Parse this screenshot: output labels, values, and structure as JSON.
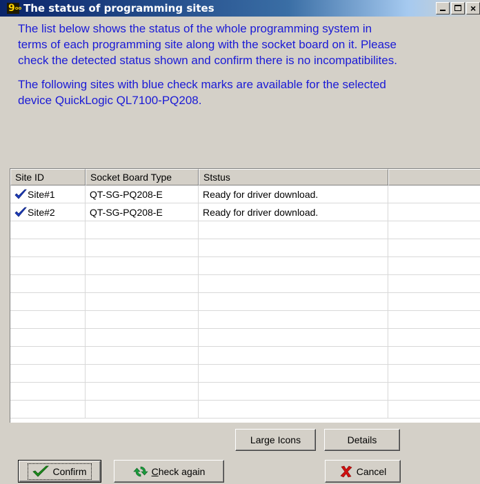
{
  "window": {
    "icon_text": "9",
    "icon_sub": "oo",
    "title": "The status of programming sites"
  },
  "description": {
    "paragraph1": "The list below shows the status of the whole programming system in terms of each programming site along with the socket board on it. Please check the detected status shown and confirm there is no incompatibilites.",
    "paragraph2": "The following sites with blue check marks are available for the selected device QuickLogic QL7100-PQ208."
  },
  "table": {
    "columns": [
      "Site ID",
      "Socket Board Type",
      "Ststus",
      ""
    ],
    "rows": [
      {
        "site_id": "Site#1",
        "socket_board": "QT-SG-PQ208-E",
        "status": "Ready for driver download.",
        "icon": "blue-check-icon"
      },
      {
        "site_id": "Site#2",
        "socket_board": "QT-SG-PQ208-E",
        "status": "Ready for driver download.",
        "icon": "blue-check-icon"
      }
    ]
  },
  "buttons": {
    "large_icons": "Large Icons",
    "details": "Details",
    "confirm": "Confirm",
    "check_again": "Check again",
    "cancel": "Cancel"
  },
  "colors": {
    "description_text": "#1a1ad6",
    "title_bar": "#0a246a",
    "check_mark": "#1f3fbf",
    "confirm_icon": "#1e8c1e",
    "refresh_icon": "#1a9c3c",
    "cancel_icon": "#d01010"
  }
}
